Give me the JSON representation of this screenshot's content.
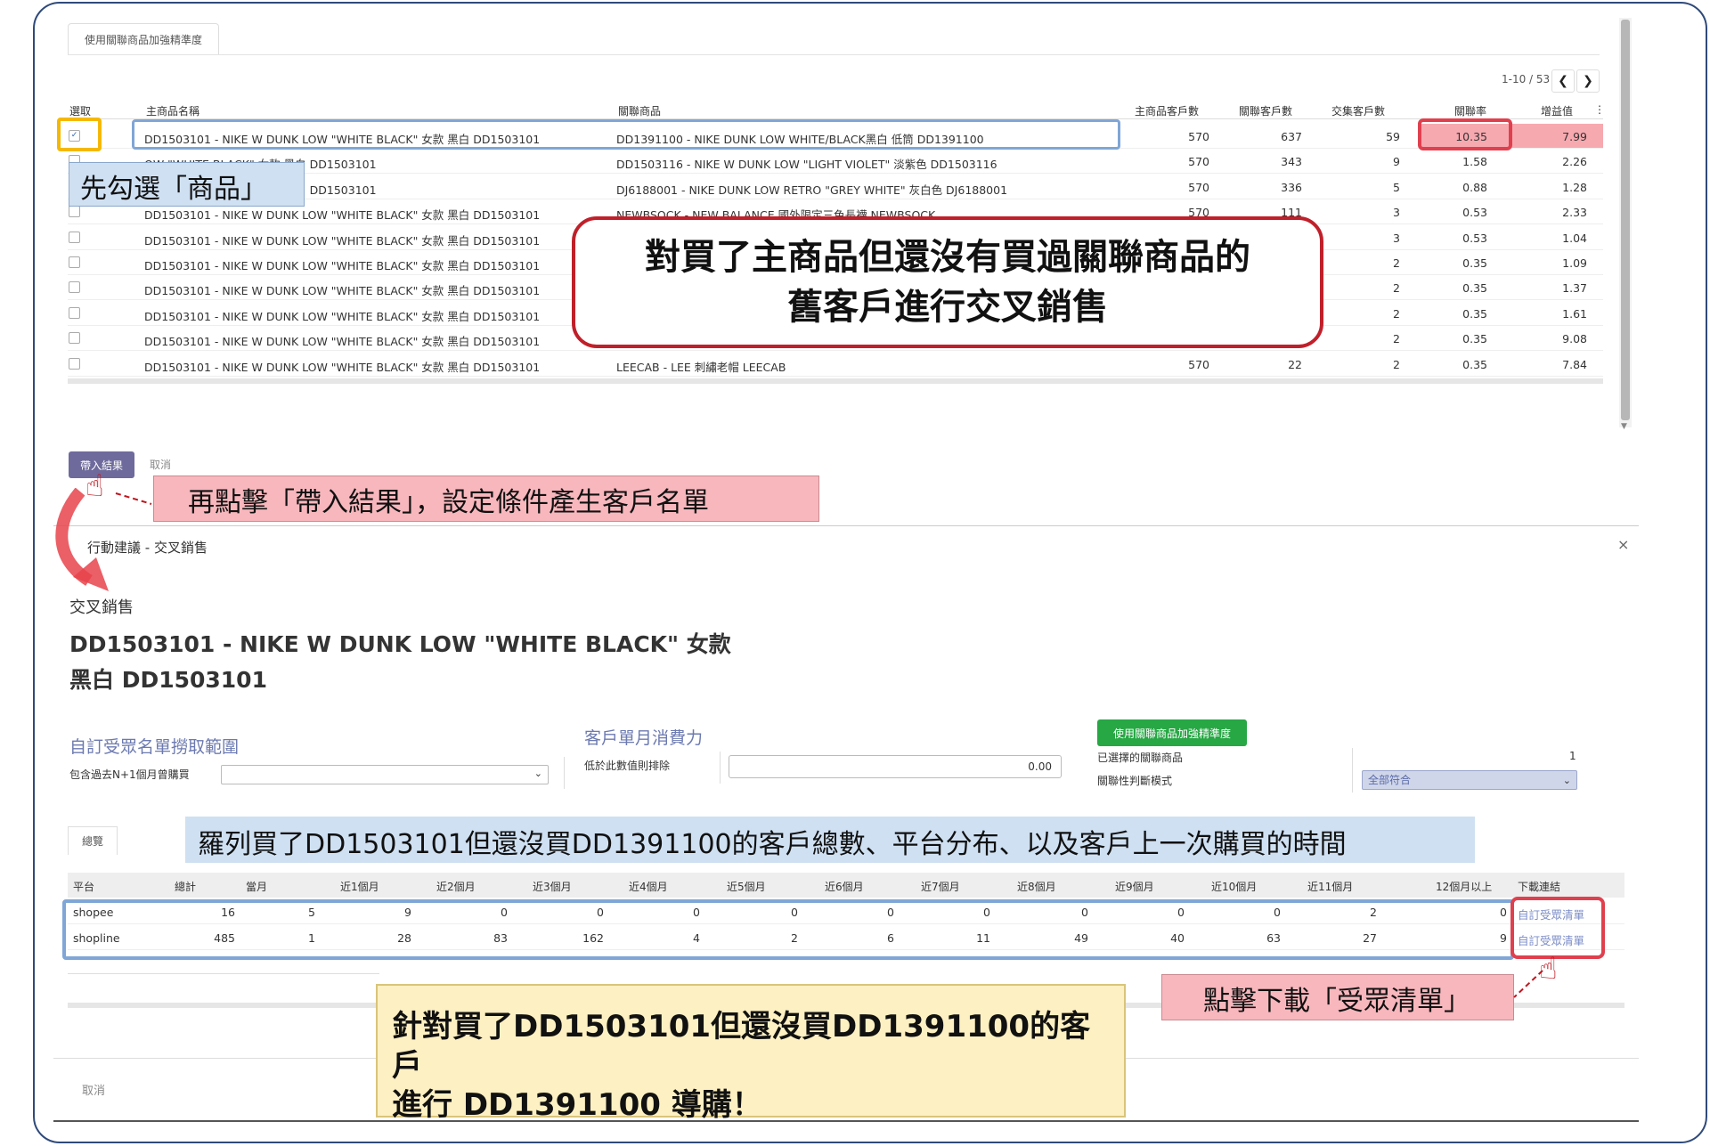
{
  "top": {
    "tab_label": "使用關聯商品加強精準度",
    "pager": "1-10 / 53",
    "columns": {
      "select": "選取",
      "main_product": "主商品名稱",
      "related_product": "關聯商品",
      "main_customers": "主商品客戶數",
      "related_customers": "關聯客戶數",
      "intersect_customers": "交集客戶數",
      "relation_rate": "關聯率",
      "lift": "增益值"
    },
    "rows": [
      {
        "main": "DD1503101 - NIKE W DUNK LOW \"WHITE BLACK\" 女款 黑白 DD1503101",
        "related": "DD1391100 - NIKE DUNK LOW WHITE/BLACK黑白 低筒 DD1391100",
        "main_c": "570",
        "rel_c": "637",
        "inter": "59",
        "rate": "10.35",
        "lift": "7.99",
        "checked": "✓"
      },
      {
        "main": "OW \"WHITE BLACK\" 女款 黑白 DD1503101",
        "related": "DD1503116 - NIKE W DUNK LOW \"LIGHT VIOLET\" 淡紫色 DD1503116",
        "main_c": "570",
        "rel_c": "343",
        "inter": "9",
        "rate": "1.58",
        "lift": "2.26",
        "checked": ""
      },
      {
        "main": "OW \"WHITE BLACK\" 女款 黑白 DD1503101",
        "related": "DJ6188001 - NIKE DUNK LOW RETRO \"GREY WHITE\" 灰白色 DJ6188001",
        "main_c": "570",
        "rel_c": "336",
        "inter": "5",
        "rate": "0.88",
        "lift": "1.28",
        "checked": ""
      },
      {
        "main": "DD1503101 - NIKE W DUNK LOW \"WHITE BLACK\" 女款 黑白 DD1503101",
        "related": "NEWBSOCK - NEW BALANCE 國外限定三色長襪 NEWBSOCK",
        "main_c": "570",
        "rel_c": "111",
        "inter": "3",
        "rate": "0.53",
        "lift": "2.33",
        "checked": ""
      },
      {
        "main": "DD1503101 - NIKE W DUNK LOW \"WHITE BLACK\" 女款 黑白 DD1503101",
        "related": "",
        "main_c": "",
        "rel_c": "",
        "inter": "3",
        "rate": "0.53",
        "lift": "1.04",
        "checked": ""
      },
      {
        "main": "DD1503101 - NIKE W DUNK LOW \"WHITE BLACK\" 女款 黑白 DD1503101",
        "related": "",
        "main_c": "",
        "rel_c": "",
        "inter": "2",
        "rate": "0.35",
        "lift": "1.09",
        "checked": ""
      },
      {
        "main": "DD1503101 - NIKE W DUNK LOW \"WHITE BLACK\" 女款 黑白 DD1503101",
        "related": "",
        "main_c": "",
        "rel_c": "",
        "inter": "2",
        "rate": "0.35",
        "lift": "1.37",
        "checked": ""
      },
      {
        "main": "DD1503101 - NIKE W DUNK LOW \"WHITE BLACK\" 女款 黑白 DD1503101",
        "related": "",
        "main_c": "",
        "rel_c": "",
        "inter": "2",
        "rate": "0.35",
        "lift": "1.61",
        "checked": ""
      },
      {
        "main": "DD1503101 - NIKE W DUNK LOW \"WHITE BLACK\" 女款 黑白 DD1503101",
        "related": "",
        "main_c": "",
        "rel_c": "",
        "inter": "2",
        "rate": "0.35",
        "lift": "9.08",
        "checked": ""
      },
      {
        "main": "DD1503101 - NIKE W DUNK LOW \"WHITE BLACK\" 女款 黑白 DD1503101",
        "related": "LEECAB - LEE 刺繡老帽 LEECAB",
        "main_c": "570",
        "rel_c": "22",
        "inter": "2",
        "rate": "0.35",
        "lift": "7.84",
        "checked": ""
      }
    ],
    "import_button": "帶入結果",
    "cancel_button": "取消"
  },
  "modal": {
    "title": "行動建議 - 交叉銷售",
    "close_icon": "×",
    "section": "交叉銷售",
    "product_title": "DD1503101 - NIKE W DUNK LOW \"WHITE BLACK\" 女款 黑白 DD1503101",
    "audience_header": "自訂受眾名單撈取範圍",
    "audience_label": "包含過去N+1個月曾購買",
    "spend_header": "客戶單月消費力",
    "spend_label": "低於此數值則排除",
    "spend_value": "0.00",
    "precision_button": "使用關聯商品加強精準度",
    "selected_related_label": "已選擇的關聯商品",
    "selected_related_value": "1",
    "mode_label": "關聯性判斷模式",
    "mode_value": "全部符合",
    "summary_tab": "總覽",
    "summary_columns": [
      "平台",
      "總計",
      "當月",
      "近1個月",
      "近2個月",
      "近3個月",
      "近4個月",
      "近5個月",
      "近6個月",
      "近7個月",
      "近8個月",
      "近9個月",
      "近10個月",
      "近11個月",
      "12個月以上",
      "下載連結"
    ],
    "summary_rows": [
      {
        "platform": "shopee",
        "values": [
          "16",
          "5",
          "9",
          "0",
          "0",
          "0",
          "0",
          "0",
          "0",
          "0",
          "0",
          "0",
          "2",
          "0"
        ],
        "link": "自訂受眾清單"
      },
      {
        "platform": "shopline",
        "values": [
          "485",
          "1",
          "28",
          "83",
          "162",
          "4",
          "2",
          "6",
          "11",
          "49",
          "40",
          "63",
          "27",
          "9"
        ],
        "link": "自訂受眾清單"
      }
    ],
    "cancel_button": "取消"
  },
  "annotations": {
    "step1": "先勾選「商品」",
    "main_callout_line1": "對買了主商品但還沒有買過關聯商品的",
    "main_callout_line2": "舊客戶進行交叉銷售",
    "step2": "再點擊「帶入結果」，設定條件產生客戶名單",
    "summary_note": "羅列買了DD1503101但還沒買DD1391100的客戶總數、平台分布、以及客戶上一次購買的時間",
    "download_note": "點擊下載「受眾清單」",
    "conclusion_line1": "針對買了DD1503101但還沒買DD1391100的客戶",
    "conclusion_line2": "進行 DD1391100 導購！"
  },
  "colors": {
    "primary_button": "#6e6a9c",
    "green_button": "#28a745",
    "highlight_red": "#e0404e",
    "highlight_blue": "#7fa6d6",
    "highlight_yellow": "#f5b800",
    "link": "#7b8cc6"
  }
}
